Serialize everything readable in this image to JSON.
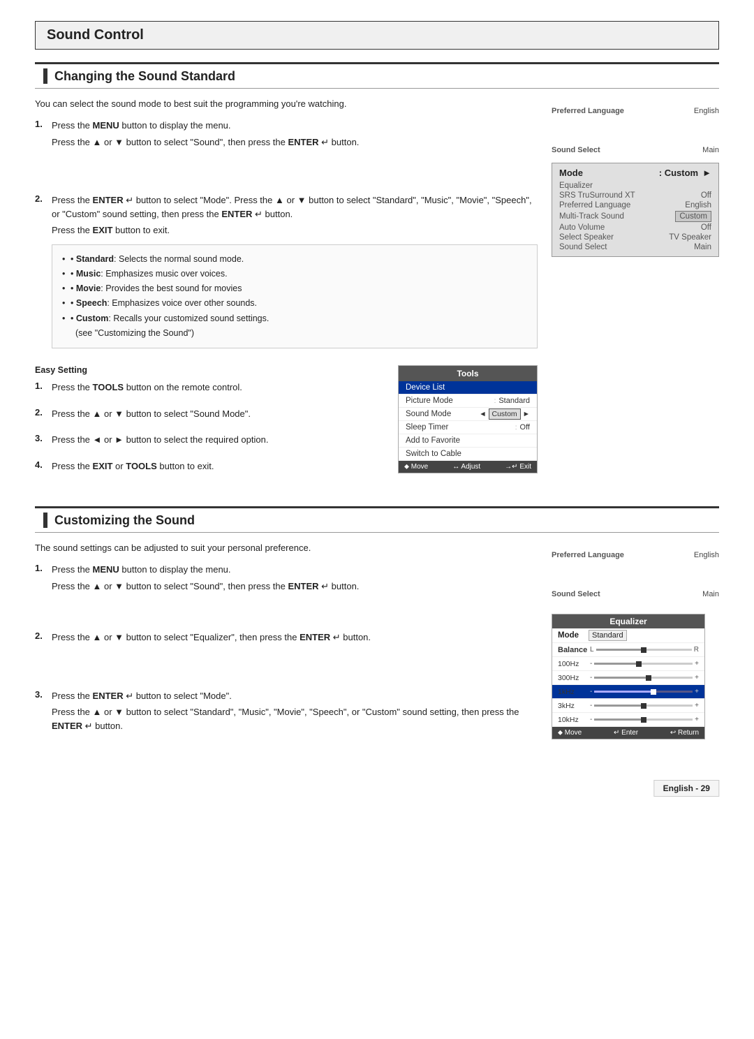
{
  "page": {
    "title": "Sound Control"
  },
  "section1": {
    "title": "Changing the Sound Standard",
    "intro": "You can select the sound mode to best suit the programming you're watching.",
    "steps": [
      {
        "num": "1.",
        "lines": [
          "Press the MENU button to display the menu.",
          "Press the ▲ or ▼ button to select \"Sound\", then press the ENTER ↵ button."
        ]
      },
      {
        "num": "2.",
        "lines": [
          "Press the ENTER ↵ button to select \"Mode\". Press the ▲ or ▼ button to select \"Standard\", \"Music\", \"Movie\", \"Speech\", or \"Custom\" sound setting, then press the ENTER ↵ button.",
          "Press the EXIT button to exit."
        ]
      }
    ],
    "bullets": [
      "Standard: Selects the normal sound mode.",
      "Music: Emphasizes music over voices.",
      "Movie: Provides the best sound for movies",
      "Speech: Emphasizes voice over other sounds.",
      "Custom: Recalls your customized sound settings. (see \"Customizing the Sound\")"
    ],
    "easy_setting": {
      "title": "Easy Setting",
      "steps": [
        {
          "num": "1.",
          "text": "Press the TOOLS button on the remote control."
        },
        {
          "num": "2.",
          "text": "Press the ▲ or ▼ button to select \"Sound Mode\"."
        },
        {
          "num": "3.",
          "text": "Press the ◄ or ► button to select the required option."
        },
        {
          "num": "4.",
          "text": "Press the EXIT or TOOLS button to exit."
        }
      ]
    }
  },
  "section2": {
    "title": "Customizing the Sound",
    "intro": "The sound settings can be adjusted to suit your personal preference.",
    "steps": [
      {
        "num": "1.",
        "lines": [
          "Press the MENU button to display the menu.",
          "Press the ▲ or ▼ button to select \"Sound\", then press the ENTER ↵ button."
        ]
      },
      {
        "num": "2.",
        "lines": [
          "Press the ▲ or ▼ button to select \"Equalizer\", then press the ENTER ↵ button."
        ]
      },
      {
        "num": "3.",
        "lines": [
          "Press the ENTER ↵ button to select \"Mode\".",
          "Press the ▲ or ▼ button to select \"Standard\", \"Music\", \"Movie\", \"Speech\", or \"Custom\" sound setting, then press the ENTER ↵ button."
        ]
      }
    ]
  },
  "sidebar1": {
    "preferred_language_label": "Preferred Language",
    "preferred_language_value": "English",
    "sound_select_label": "Sound Select",
    "sound_select_value": "Main",
    "mode_label": "Mode",
    "mode_value": ": Custom",
    "equalizer_label": "Equalizer",
    "srs_label": "SRS TruSurround XT",
    "srs_value": "Off",
    "pref_lang_label": "Preferred Language",
    "pref_lang_value": "English",
    "multitrack_label": "Multi-Track Sound",
    "multitrack_value": "Custom",
    "auto_volume_label": "Auto Volume",
    "auto_volume_value": "Off",
    "select_speaker_label": "Select Speaker",
    "select_speaker_value": "TV Speaker",
    "sound_select2_label": "Sound Select",
    "sound_select2_value": "Main"
  },
  "tools_menu": {
    "title": "Tools",
    "items": [
      {
        "label": "Device List",
        "value": "",
        "highlighted": true
      },
      {
        "label": "Picture Mode",
        "value": "Standard",
        "highlighted": false
      },
      {
        "label": "Sound Mode",
        "value": "◄  Custom  ►",
        "highlighted": false
      },
      {
        "label": "Sleep Timer",
        "value": "Off",
        "highlighted": false
      },
      {
        "label": "Add to Favorite",
        "value": "",
        "highlighted": false
      },
      {
        "label": "Switch to Cable",
        "value": "",
        "highlighted": false
      }
    ],
    "footer": {
      "move": "⬥ Move",
      "adjust": "↔ Adjust",
      "exit": "→↵ Exit"
    }
  },
  "sidebar2": {
    "preferred_language_label": "Preferred Language",
    "preferred_language_value": "English",
    "sound_select_label": "Sound Select",
    "sound_select_value": "Main"
  },
  "equalizer_panel": {
    "title": "Equalizer",
    "mode_label": "Mode",
    "mode_value": "Standard",
    "rows": [
      {
        "label": "Balance",
        "left": "L",
        "right": "R",
        "pos": 50
      },
      {
        "label": "100Hz",
        "minus": "-",
        "plus": "+",
        "pos": 45
      },
      {
        "label": "300Hz",
        "minus": "-",
        "plus": "+",
        "pos": 55,
        "highlighted": false
      },
      {
        "label": "1kHz",
        "minus": "-",
        "plus": "+",
        "pos": 60,
        "highlighted": true
      },
      {
        "label": "3kHz",
        "minus": "-",
        "plus": "+",
        "pos": 50
      },
      {
        "label": "10kHz",
        "minus": "-",
        "plus": "+",
        "pos": 50
      }
    ],
    "footer": {
      "move": "⬥ Move",
      "enter": "↵ Enter",
      "return": "↩ Return"
    }
  },
  "page_number": "English - 29"
}
